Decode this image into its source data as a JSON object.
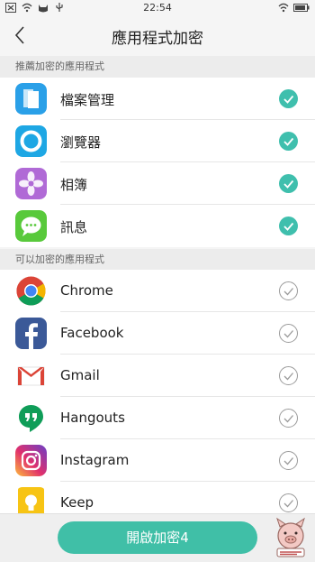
{
  "status_bar": {
    "time": "22:54"
  },
  "header": {
    "title": "應用程式加密"
  },
  "sections": [
    {
      "title": "推薦加密的應用程式",
      "items": [
        {
          "label": "檔案管理",
          "icon": "file-manager-icon",
          "checked": true
        },
        {
          "label": "瀏覽器",
          "icon": "browser-icon",
          "checked": true
        },
        {
          "label": "相簿",
          "icon": "photos-icon",
          "checked": true
        },
        {
          "label": "訊息",
          "icon": "messages-icon",
          "checked": true
        }
      ]
    },
    {
      "title": "可以加密的應用程式",
      "items": [
        {
          "label": "Chrome",
          "icon": "chrome-icon",
          "checked": false
        },
        {
          "label": "Facebook",
          "icon": "facebook-icon",
          "checked": false
        },
        {
          "label": "Gmail",
          "icon": "gmail-icon",
          "checked": false
        },
        {
          "label": "Hangouts",
          "icon": "hangouts-icon",
          "checked": false
        },
        {
          "label": "Instagram",
          "icon": "instagram-icon",
          "checked": false
        },
        {
          "label": "Keep",
          "icon": "keep-icon",
          "checked": false
        }
      ]
    }
  ],
  "footer": {
    "encrypt_button_label": "開啟加密4"
  },
  "colors": {
    "accent": "#40bfa7",
    "check": "#3fbfad"
  }
}
